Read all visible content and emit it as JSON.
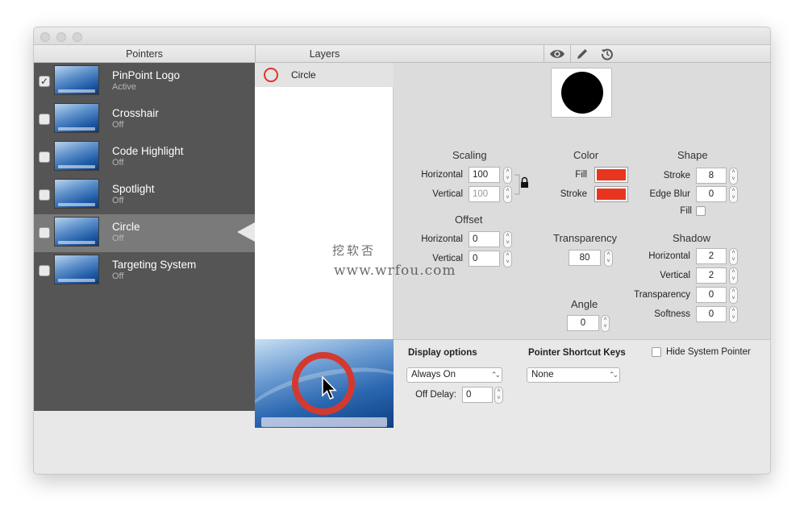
{
  "pointers_header": "Pointers",
  "layers_header": "Layers",
  "toolbar": {
    "icons": [
      "eye-icon",
      "pencil-icon",
      "history-icon"
    ]
  },
  "pointers": [
    {
      "name": "PinPoint Logo",
      "status": "Active",
      "checked": true
    },
    {
      "name": "Crosshair",
      "status": "Off",
      "checked": false
    },
    {
      "name": "Code Highlight",
      "status": "Off",
      "checked": false
    },
    {
      "name": "Spotlight",
      "status": "Off",
      "checked": false
    },
    {
      "name": "Circle",
      "status": "Off",
      "checked": false
    },
    {
      "name": "Targeting System",
      "status": "Off",
      "checked": false
    }
  ],
  "selected_pointer": "Circle",
  "layers": [
    {
      "name": "Circle"
    }
  ],
  "scaling": {
    "title": "Scaling",
    "horizontal_label": "Horizontal",
    "horizontal": "100",
    "vertical_label": "Vertical",
    "vertical": "100"
  },
  "offset": {
    "title": "Offset",
    "horizontal_label": "Horizontal",
    "horizontal": "0",
    "vertical_label": "Vertical",
    "vertical": "0"
  },
  "color": {
    "title": "Color",
    "fill_label": "Fill",
    "stroke_label": "Stroke",
    "fill_color": "#e8351f",
    "stroke_color": "#e8351f"
  },
  "transparency": {
    "title": "Transparency",
    "value": "80"
  },
  "angle": {
    "title": "Angle",
    "value": "0"
  },
  "shape": {
    "title": "Shape",
    "stroke_label": "Stroke",
    "stroke": "8",
    "edge_blur_label": "Edge Blur",
    "edge_blur": "0",
    "fill_label": "Fill",
    "fill_checked": false
  },
  "shadow": {
    "title": "Shadow",
    "horizontal_label": "Horizontal",
    "horizontal": "2",
    "vertical_label": "Vertical",
    "vertical": "2",
    "transparency_label": "Transparency",
    "transparency": "0",
    "softness_label": "Softness",
    "softness": "0"
  },
  "display_options": {
    "label": "Display options",
    "value": "Always On",
    "off_delay_label": "Off Delay:",
    "off_delay": "0"
  },
  "shortcut": {
    "label": "Pointer Shortcut Keys",
    "value": "None"
  },
  "hide_system_pointer": {
    "label": "Hide System Pointer",
    "checked": false
  },
  "watermark": {
    "line1": "挖软否",
    "line2": "www.wrfou.com"
  }
}
